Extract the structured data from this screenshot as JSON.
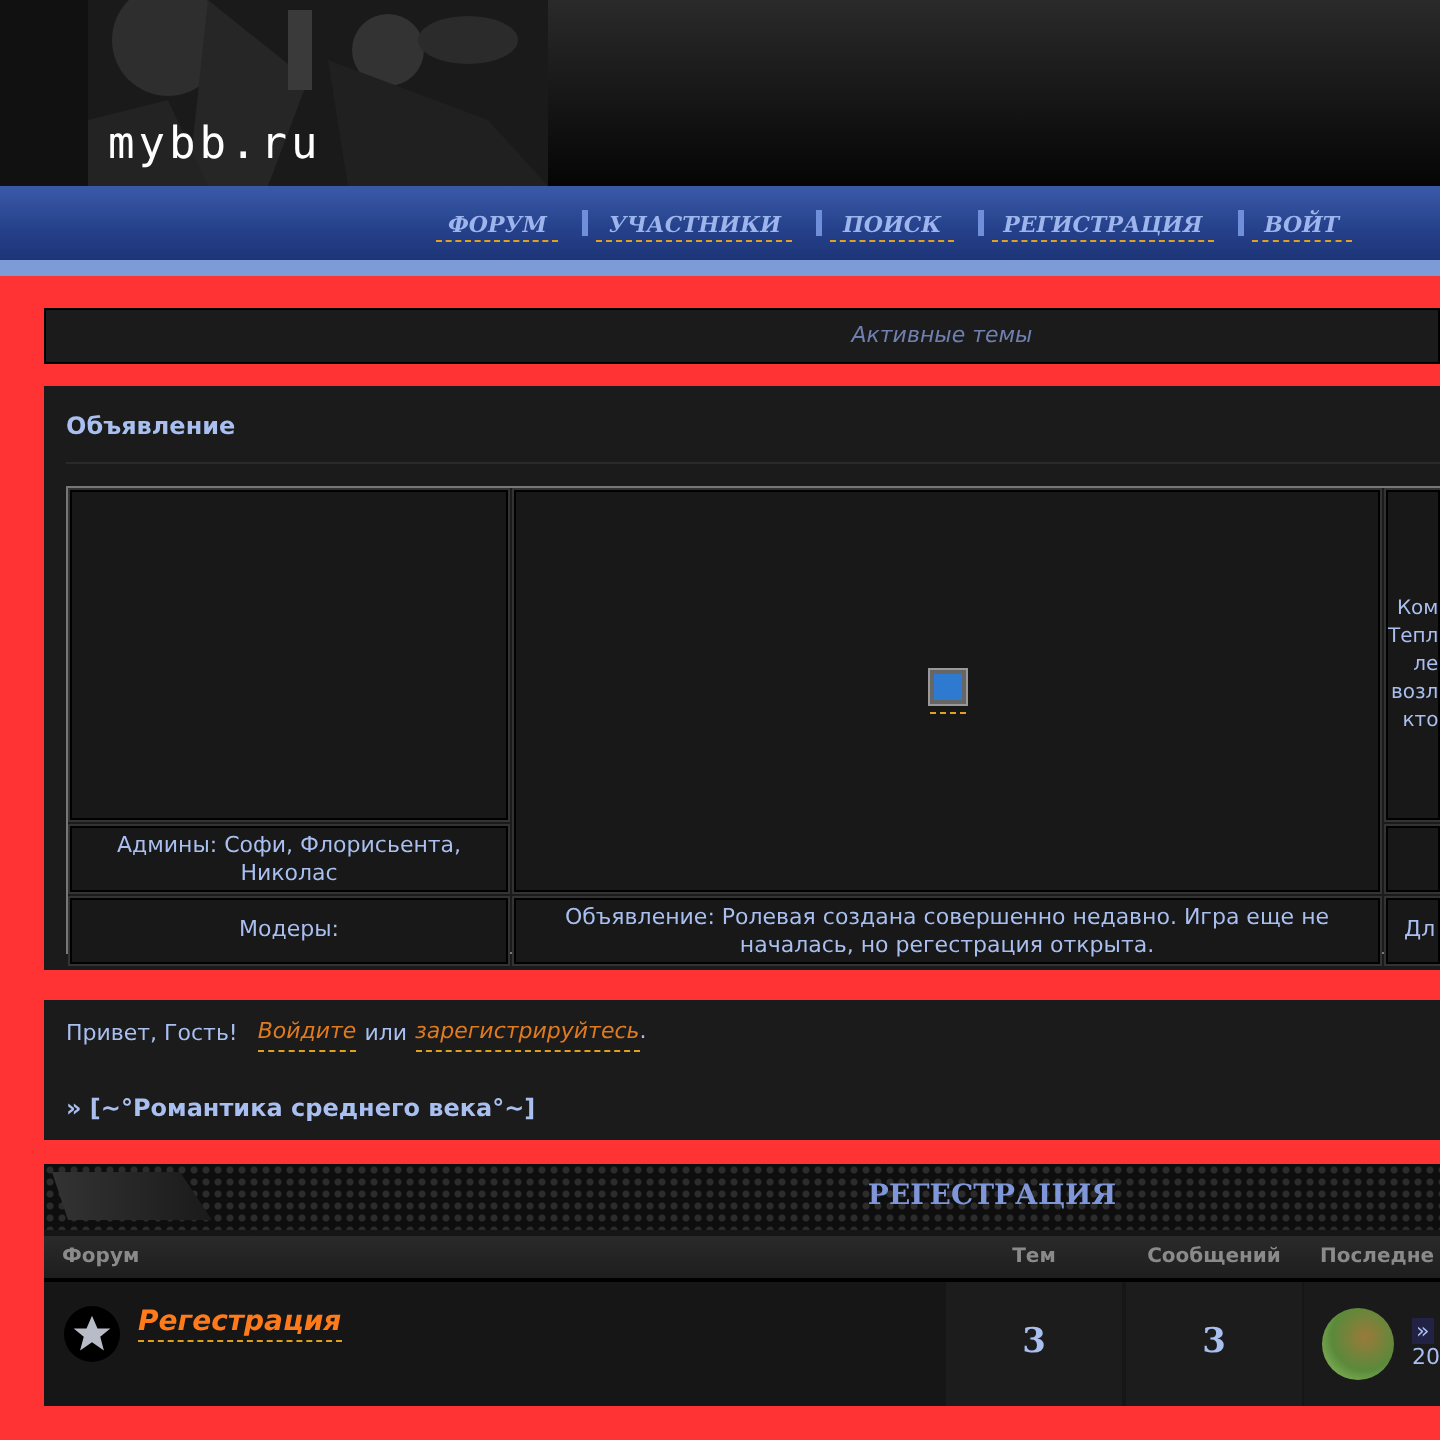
{
  "header": {
    "logo": "mybb.ru"
  },
  "nav": [
    {
      "label": "ФОРУМ"
    },
    {
      "label": "УЧАСТНИКИ"
    },
    {
      "label": "ПОИСК"
    },
    {
      "label": "РЕГИСТРАЦИЯ"
    },
    {
      "label": "ВОЙТ"
    }
  ],
  "active_topics": "Активные темы",
  "announcement": {
    "title": "Объявление",
    "admins": "Админы: Софи, Флорисьента, Николас",
    "moders": "Модеры:",
    "text": "Объявление: Ролевая создана совершенно недавно. Игра еще не началась, но регестрация открыта.",
    "right_lines": [
      "Ком",
      "Тепл",
      "ле",
      "возл",
      "кто"
    ],
    "right_bottom": "Дл"
  },
  "welcome": {
    "greeting": "Привет, Гость!",
    "login": "Войдите",
    "or": "или",
    "register": "зарегистрируйтесь",
    "end": ".",
    "forum_title": "» [~°Романтика среднего века°~]"
  },
  "category": {
    "title": "РЕГЕСТРАЦИЯ",
    "columns": [
      "Форум",
      "Тем",
      "Сообщений",
      "Последне"
    ],
    "rows": [
      {
        "name": "Регестрация",
        "topics": "3",
        "posts": "3",
        "last_link": "»",
        "last_date": "20"
      }
    ]
  }
}
